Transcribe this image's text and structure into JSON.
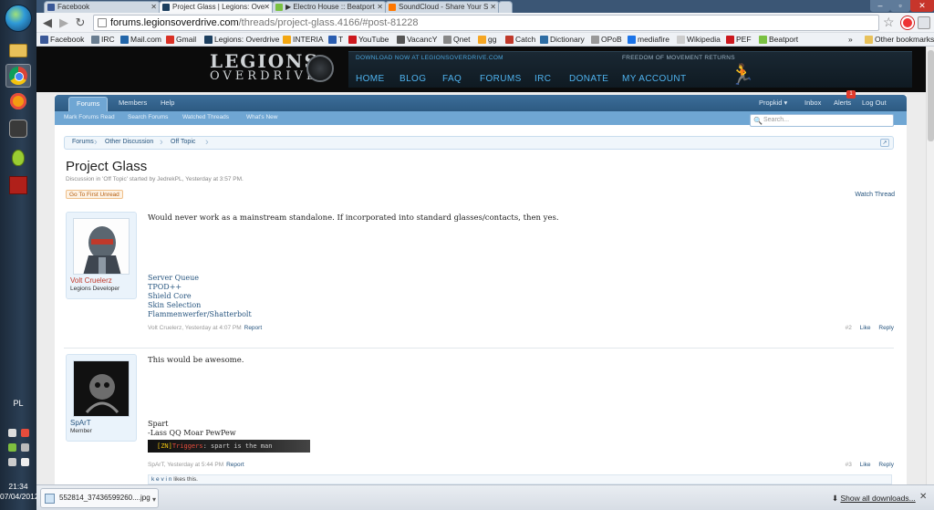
{
  "taskbar": {
    "language": "PL",
    "time": "21:34",
    "date": "07/04/2012"
  },
  "browser": {
    "tabs": [
      {
        "label": "Facebook",
        "active": false
      },
      {
        "label": "Project Glass | Legions: Ove",
        "active": true
      },
      {
        "label": "▶ Electro House :: Beatport",
        "active": false
      },
      {
        "label": "SoundCloud - Share Your S",
        "active": false
      }
    ],
    "url_host": "forums.legionsoverdrive.com",
    "url_path": "/threads/project-glass.4166/#post-81228",
    "bookmarks": [
      "Facebook",
      "IRC",
      "Mail.com",
      "Gmail",
      "Legions: Overdrive",
      "INTERIA",
      "T",
      "YouTube",
      "VacancY",
      "Qnet",
      "gg",
      "Catch",
      "Dictionary",
      "OPoB",
      "mediafire",
      "Wikipedia",
      "PEF",
      "Beatport"
    ],
    "other_bookmarks": "Other bookmarks",
    "more_bookmarks": "»"
  },
  "site": {
    "logo_line1": "LEGIONS",
    "logo_line2": "OVERDRIVE",
    "tagline_left": "DOWNLOAD NOW AT LEGIONSOVERDRIVE.COM",
    "tagline_right": "FREEDOM OF MOVEMENT RETURNS",
    "nav": [
      "HOME",
      "BLOG",
      "FAQ",
      "FORUMS",
      "IRC",
      "DONATE",
      "MY ACCOUNT"
    ]
  },
  "forum": {
    "tabs": [
      "Forums",
      "Members",
      "Help"
    ],
    "user_menu": {
      "user": "Propkid",
      "inbox": "Inbox",
      "alerts": "Alerts",
      "alerts_count": "1",
      "logout": "Log Out"
    },
    "subnav": [
      "Mark Forums Read",
      "Search Forums",
      "Watched Threads",
      "What's New"
    ],
    "search_placeholder": "Search...",
    "breadcrumb": [
      "Forums",
      "Other Discussion",
      "Off Topic"
    ],
    "thread_title": "Project Glass",
    "thread_meta": "Discussion in 'Off Topic' started by JedrekPL, Yesterday at 3:57 PM.",
    "go_first_unread": "Go To First Unread",
    "watch_thread": "Watch Thread"
  },
  "posts": [
    {
      "username": "Volt Cruelerz",
      "user_title": "Legions Developer",
      "message": "Would never work as a mainstream standalone. If incorporated into standard glasses/contacts, then yes.",
      "signature_links": [
        "Server Queue",
        "TPOD++",
        "Shield Core",
        "Skin Selection",
        "Flammenwerfer/Shatterbolt"
      ],
      "meta": "Volt Cruelerz, Yesterday at 4:07 PM",
      "report": "Report",
      "number": "#2",
      "like": "Like",
      "reply": "Reply"
    },
    {
      "username": "SpArT",
      "user_title": "Member",
      "message": "This would be awesome.",
      "signature_lines": [
        "Spart",
        "-Lass QQ Moar PewPew"
      ],
      "sig_banner_tag": "[ZN]",
      "sig_banner_name": "Triggers",
      "sig_banner_text": ": spart is the man",
      "meta": "SpArT, Yesterday at 5:44 PM",
      "report": "Report",
      "number": "#3",
      "like": "Like",
      "reply": "Reply",
      "likes_user": "k e v i n",
      "likes_text": "likes this."
    }
  ],
  "downloads": {
    "file": "552814_37436599260....jpg",
    "show_all": "Show all downloads..."
  }
}
